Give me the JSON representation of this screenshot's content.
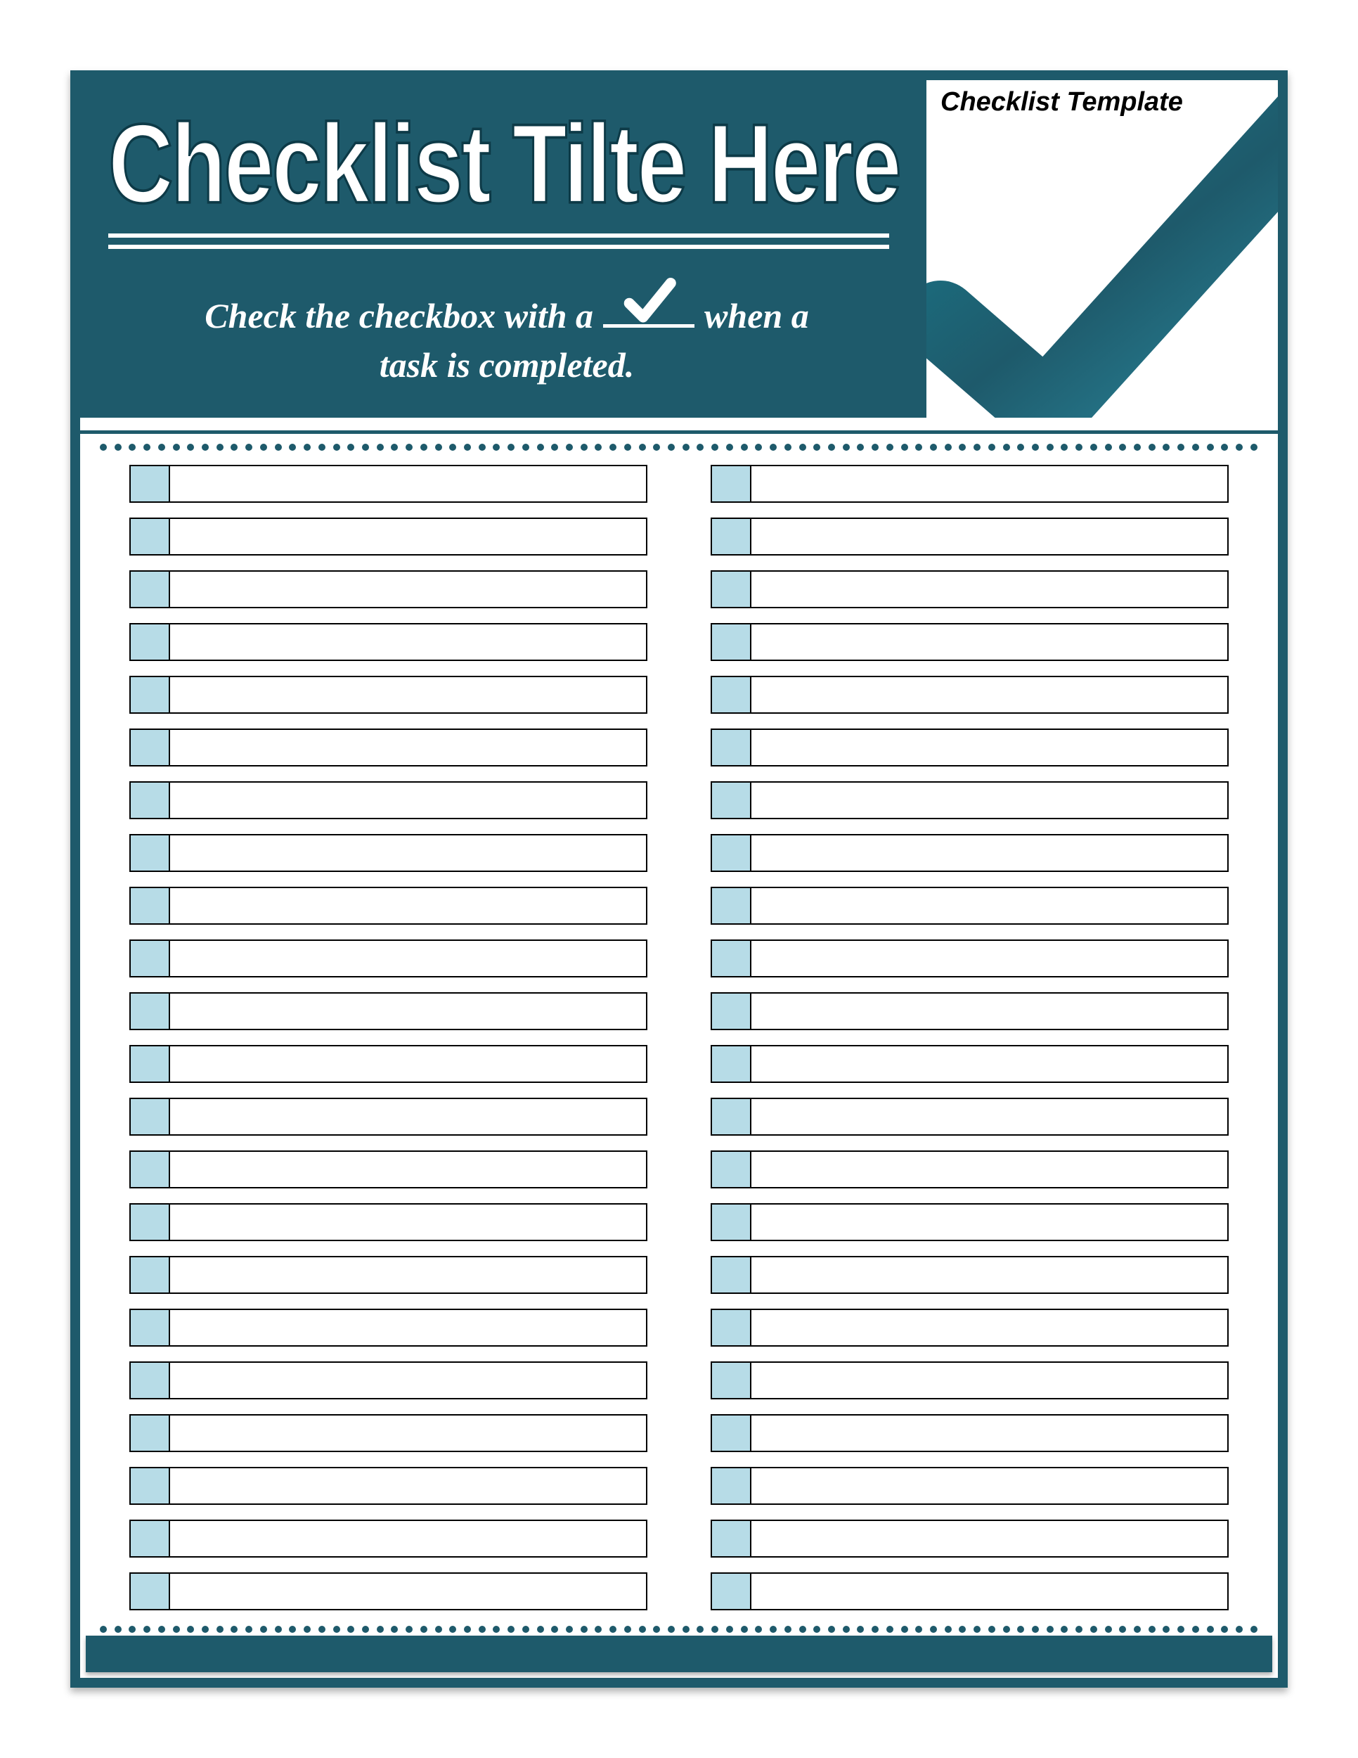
{
  "header": {
    "title": "Checklist Tilte Here",
    "badge_label": "Checklist Template",
    "instruction_part1": "Check the checkbox with a",
    "instruction_part2": "when a",
    "instruction_part3": "task is completed."
  },
  "colors": {
    "primary": "#1e5a6b",
    "checkbox_fill": "#b7dce7",
    "white": "#ffffff"
  },
  "layout": {
    "rows_per_column": 22,
    "columns": 2,
    "dot_count": 80
  },
  "checklist": {
    "left": [
      "",
      "",
      "",
      "",
      "",
      "",
      "",
      "",
      "",
      "",
      "",
      "",
      "",
      "",
      "",
      "",
      "",
      "",
      "",
      "",
      "",
      ""
    ],
    "right": [
      "",
      "",
      "",
      "",
      "",
      "",
      "",
      "",
      "",
      "",
      "",
      "",
      "",
      "",
      "",
      "",
      "",
      "",
      "",
      "",
      "",
      ""
    ]
  }
}
